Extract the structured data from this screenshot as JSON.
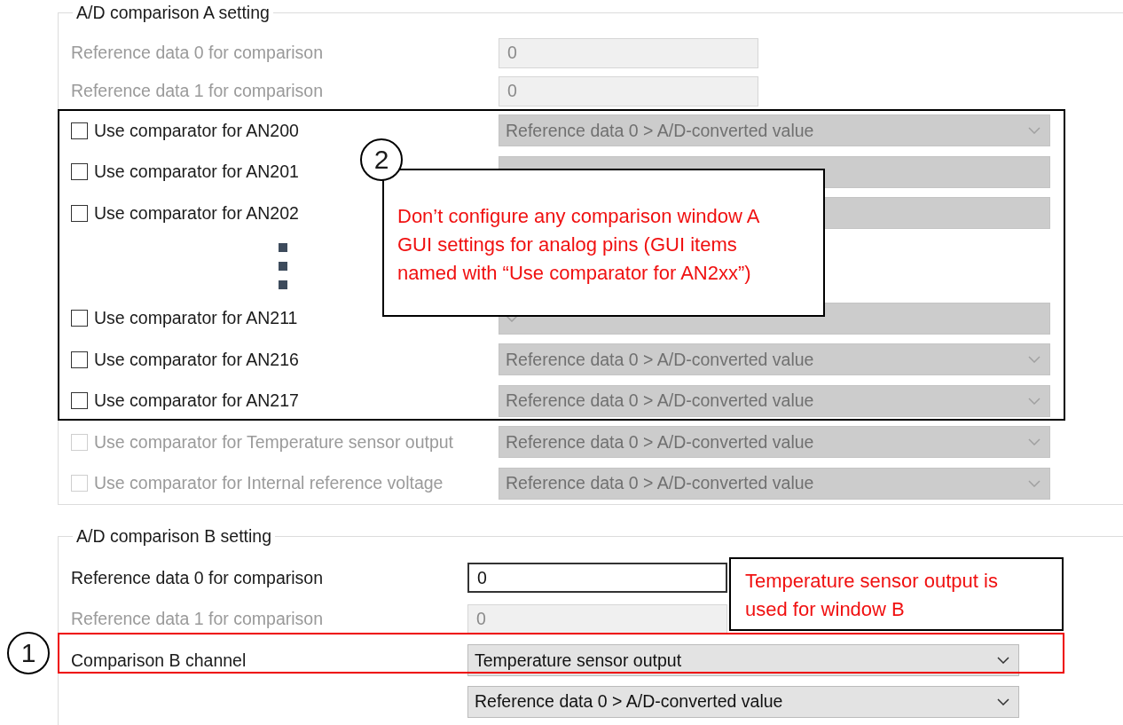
{
  "group_a": {
    "title": "A/D comparison A setting",
    "rows": [
      {
        "kind": "field",
        "label": "Reference data 0 for comparison",
        "value": "0",
        "disabled": true
      },
      {
        "kind": "field",
        "label": "Reference data 1 for comparison",
        "value": "0",
        "disabled": true
      },
      {
        "kind": "checkbox",
        "label": "Use comparator for AN200",
        "checked": false,
        "disabled": false,
        "select": {
          "value": "Reference data 0 > A/D-converted value",
          "disabled": true
        }
      },
      {
        "kind": "checkbox",
        "label": "Use comparator for AN201",
        "checked": false,
        "disabled": false,
        "select": {
          "disabled": true
        }
      },
      {
        "kind": "checkbox",
        "label": "Use comparator for AN202",
        "checked": false,
        "disabled": false,
        "select": {
          "disabled": true
        }
      },
      {
        "kind": "ellipsis"
      },
      {
        "kind": "checkbox",
        "label": "Use comparator for AN211",
        "checked": false,
        "disabled": false,
        "select": {
          "disabled": true
        }
      },
      {
        "kind": "checkbox",
        "label": "Use comparator for AN216",
        "checked": false,
        "disabled": false,
        "select": {
          "value": "Reference data 0 > A/D-converted value",
          "disabled": true
        }
      },
      {
        "kind": "checkbox",
        "label": "Use comparator for AN217",
        "checked": false,
        "disabled": false,
        "select": {
          "value": "Reference data 0 > A/D-converted value",
          "disabled": true
        }
      },
      {
        "kind": "checkbox",
        "label": "Use comparator for Temperature sensor output",
        "checked": false,
        "disabled": true,
        "select": {
          "value": "Reference data 0 > A/D-converted value",
          "disabled": true
        }
      },
      {
        "kind": "checkbox",
        "label": "Use comparator for Internal reference voltage",
        "checked": false,
        "disabled": true,
        "select": {
          "value": "Reference data 0 > A/D-converted value",
          "disabled": true
        }
      }
    ]
  },
  "group_b": {
    "title": "A/D comparison B setting",
    "rows": [
      {
        "kind": "field",
        "label": "Reference data 0 for comparison",
        "value": "0",
        "disabled": false
      },
      {
        "kind": "field",
        "label": "Reference data 1 for comparison",
        "value": "0",
        "disabled": true
      },
      {
        "kind": "select",
        "label": "Comparison B channel",
        "select": {
          "value": "Temperature sensor output",
          "disabled": false
        }
      },
      {
        "kind": "select",
        "select": {
          "value": "Reference data 0 > A/D-converted value",
          "disabled": false
        }
      }
    ]
  },
  "markers": [
    {
      "number": "2"
    },
    {
      "number": "1"
    }
  ],
  "notes": [
    {
      "text": "Don’t configure any comparison window A GUI settings for analog pins (GUI items named with “Use comparator for AN2xx”)"
    },
    {
      "text": "Temperature sensor output is used for window B"
    }
  ]
}
